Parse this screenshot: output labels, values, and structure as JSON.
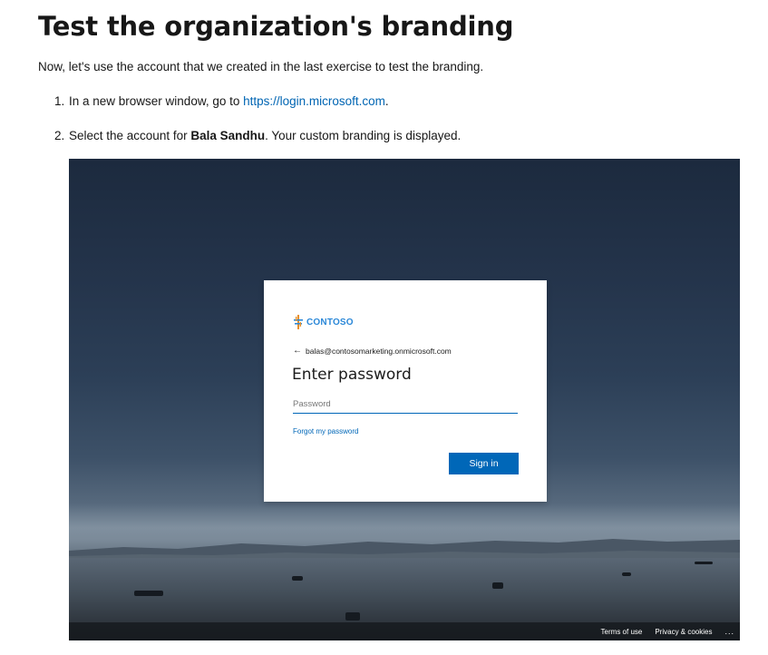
{
  "article": {
    "title": "Test the organization's branding",
    "intro": "Now, let's use the account that we created in the last exercise to test the branding.",
    "steps": [
      {
        "number": "1.",
        "before": "In a new browser window, go to ",
        "link": "https://login.microsoft.com",
        "after": "."
      },
      {
        "number": "2.",
        "before": "Select the account for ",
        "bold": "Bala Sandhu",
        "after": ". Your custom branding is displayed."
      }
    ]
  },
  "signin": {
    "brand": {
      "name": "CONTOSO",
      "logo_icon": "contoso-logo-icon",
      "color": "#2b88d8"
    },
    "back_icon": "back-arrow-icon",
    "account": "balas@contosomarketing.onmicrosoft.com",
    "title": "Enter password",
    "password_placeholder": "Password",
    "password_value": "",
    "forgot_link": "Forgot my password",
    "submit_label": "Sign in",
    "accent_color": "#0067b8"
  },
  "footer": {
    "terms": "Terms of use",
    "privacy": "Privacy & cookies",
    "more": "..."
  }
}
